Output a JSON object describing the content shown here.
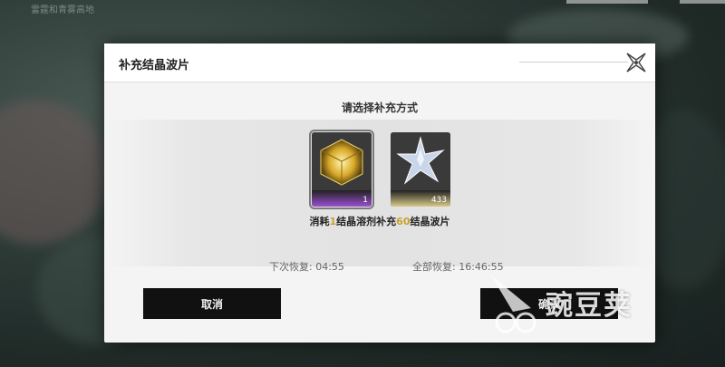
{
  "background": {
    "map_label": "雷霆和青雾高地"
  },
  "dialog": {
    "title": "补充结晶波片",
    "subtitle": "请选择补充方式",
    "options": [
      {
        "name": "结晶溶剂",
        "icon": "golden-cube-icon",
        "count": "1",
        "selected": true,
        "strip_color": "#9b4fd0"
      },
      {
        "name": "结晶",
        "icon": "crystal-star-icon",
        "count": "433",
        "selected": false,
        "strip_color": "#d9c98a"
      }
    ],
    "description": {
      "p1": "消耗",
      "n1": "1",
      "p2": "结晶溶剂补充",
      "n2": "60",
      "p3": "结晶波片"
    },
    "next_recovery_label": "下次恢复:",
    "next_recovery_time": "04:55",
    "full_recovery_label": "全部恢复:",
    "full_recovery_time": "16:46:55",
    "cancel_label": "取消",
    "confirm_label": "确认"
  },
  "watermark": {
    "text": "豌豆荚"
  },
  "colors": {
    "highlight": "#c9a12a",
    "button_bg": "#111111"
  }
}
